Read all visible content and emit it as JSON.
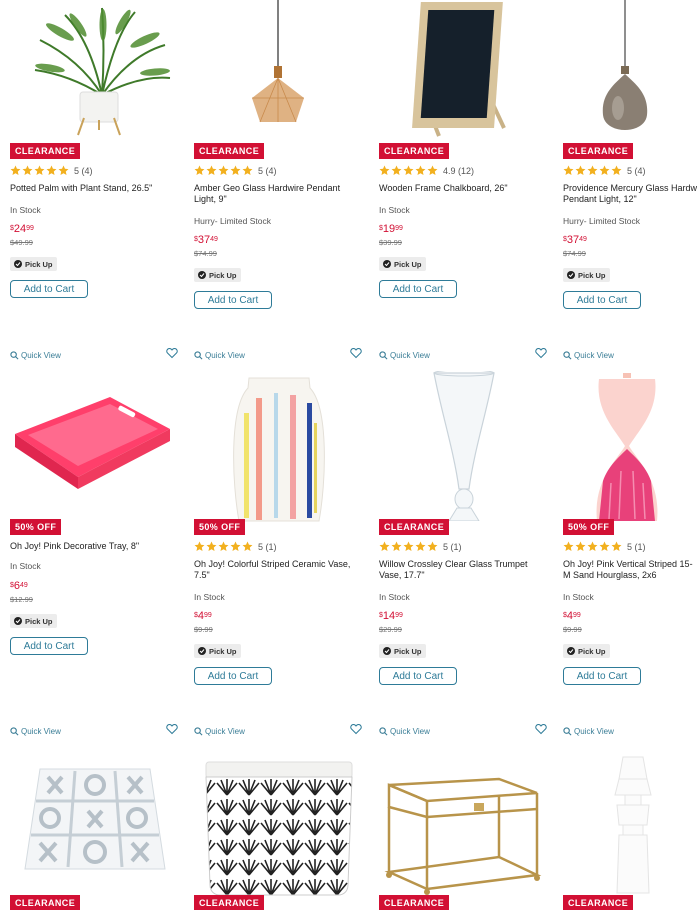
{
  "quick_view_label": "Quick View",
  "products": [
    {
      "badge": "CLEARANCE",
      "rating_text": "5 (4)",
      "name": "Potted Palm with Plant Stand, 26.5\"",
      "stock": "In Stock",
      "price_dollars": "24",
      "price_cents": "99",
      "was": "$49.99",
      "pickup": "Pick Up",
      "cta": "Add to Cart",
      "image": "potted-palm"
    },
    {
      "badge": "CLEARANCE",
      "rating_text": "5 (4)",
      "name": "Amber Geo Glass Hardwire Pendant Light, 9\"",
      "stock": "Hurry- Limited Stock",
      "price_dollars": "37",
      "price_cents": "49",
      "was": "$74.99",
      "pickup": "Pick Up",
      "cta": "Add to Cart",
      "image": "amber-pendant"
    },
    {
      "badge": "CLEARANCE",
      "rating_text": "4.9 (12)",
      "name": "Wooden Frame Chalkboard, 26\"",
      "stock": "In Stock",
      "price_dollars": "19",
      "price_cents": "99",
      "was": "$39.99",
      "pickup": "Pick Up",
      "cta": "Add to Cart",
      "image": "chalkboard"
    },
    {
      "badge": "CLEARANCE",
      "rating_text": "5 (4)",
      "name": "Providence Mercury Glass Hardw Pendant Light, 12\"",
      "stock": "Hurry- Limited Stock",
      "price_dollars": "37",
      "price_cents": "49",
      "was": "$74.99",
      "pickup": "Pick Up",
      "cta": "Add to Cart",
      "image": "mercury-pendant"
    },
    {
      "badge": "50% OFF",
      "rating_text": "",
      "name": "Oh Joy! Pink Decorative Tray, 8\"",
      "stock": "In Stock",
      "price_dollars": "6",
      "price_cents": "49",
      "was": "$12.99",
      "pickup": "Pick Up",
      "cta": "Add to Cart",
      "image": "pink-tray"
    },
    {
      "badge": "50% OFF",
      "rating_text": "5 (1)",
      "name": "Oh Joy! Colorful Striped Ceramic Vase, 7.5\"",
      "stock": "In Stock",
      "price_dollars": "4",
      "price_cents": "99",
      "was": "$9.99",
      "pickup": "Pick Up",
      "cta": "Add to Cart",
      "image": "striped-vase"
    },
    {
      "badge": "CLEARANCE",
      "rating_text": "5 (1)",
      "name": "Willow Crossley Clear Glass Trumpet Vase, 17.7\"",
      "stock": "In Stock",
      "price_dollars": "14",
      "price_cents": "99",
      "was": "$29.99",
      "pickup": "Pick Up",
      "cta": "Add to Cart",
      "image": "trumpet-vase"
    },
    {
      "badge": "50% OFF",
      "rating_text": "5 (1)",
      "name": "Oh Joy! Pink Vertical Striped 15-M Sand Hourglass, 2x6",
      "stock": "In Stock",
      "price_dollars": "4",
      "price_cents": "99",
      "was": "$9.99",
      "pickup": "Pick Up",
      "cta": "Add to Cart",
      "image": "hourglass"
    },
    {
      "badge": "CLEARANCE",
      "image": "tic-tac-toe"
    },
    {
      "badge": "CLEARANCE",
      "image": "fan-pattern-planter"
    },
    {
      "badge": "CLEARANCE",
      "image": "glass-box"
    },
    {
      "badge": "CLEARANCE",
      "image": "white-candle"
    }
  ],
  "colors": {
    "accent_red": "#d21034",
    "link_teal": "#2e7b98",
    "star_gold": "#f2b01e"
  }
}
